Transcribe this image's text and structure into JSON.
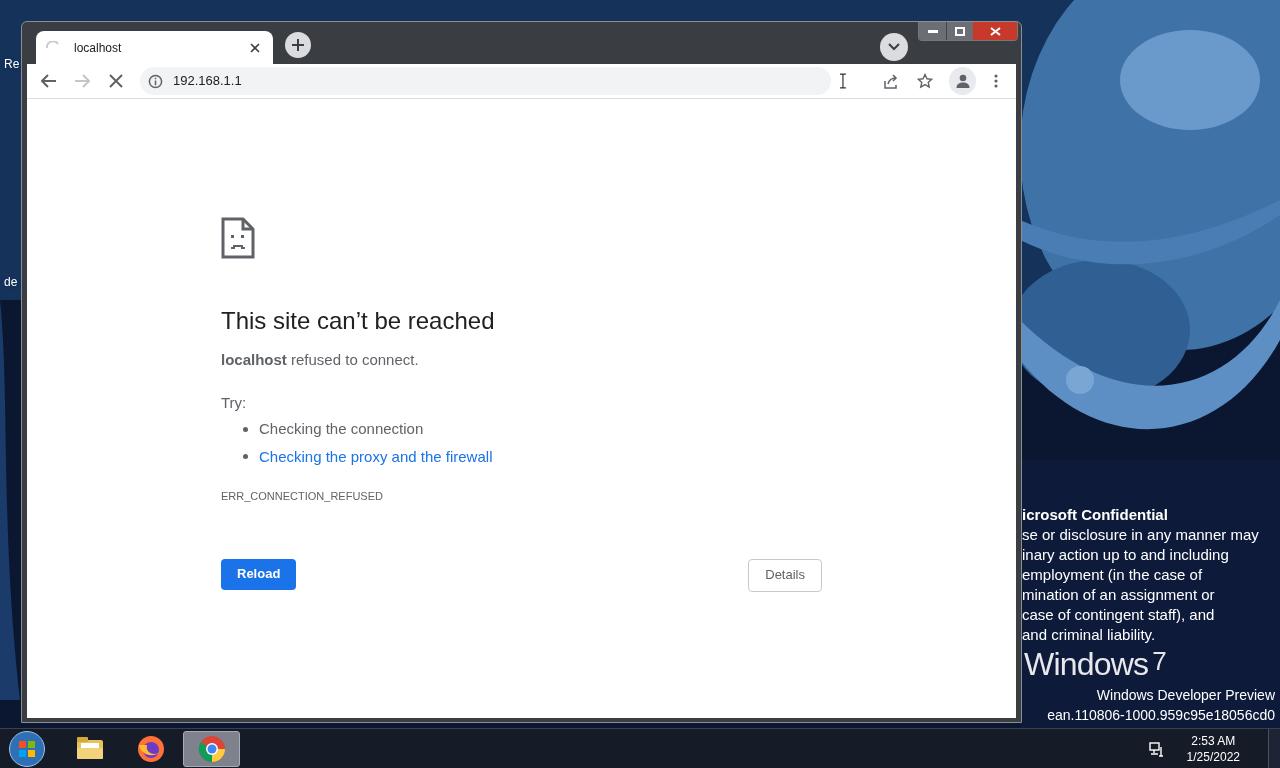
{
  "desktop": {
    "icon_labels": [
      "Re",
      "de"
    ],
    "notice": {
      "title": "icrosoft Confidential",
      "lines": [
        "se or disclosure in any manner may",
        "inary action up to and including",
        "employment (in the case of",
        "mination of an assignment or",
        "case of contingent staff), and",
        "and criminal liability."
      ]
    },
    "edition": "Windows Developer Preview",
    "build": "ean.110806-1000.959c95e18056cd0",
    "logo_word": "Windows",
    "logo_version": "7"
  },
  "browser": {
    "tabs": [
      {
        "title": "localhost",
        "selected": true,
        "loading": true
      }
    ],
    "address": "192.168.1.1",
    "loading": true,
    "page": {
      "heading": "This site can’t be reached",
      "message": "**localhost** refused to connect.",
      "try_label": "Try:",
      "suggestions": [
        {
          "text": "Checking the connection",
          "kind": "text"
        },
        {
          "text": "Checking the proxy and the firewall",
          "kind": "link"
        }
      ],
      "error_code": "ERR_CONNECTION_REFUSED",
      "buttons": [
        {
          "label": "Reload",
          "kind": "primary"
        },
        {
          "label": "Details",
          "kind": "secondary"
        }
      ]
    }
  },
  "taskbar": {
    "apps": [
      {
        "kind": "folder",
        "selected": false
      },
      {
        "kind": "firefox",
        "selected": false
      },
      {
        "kind": "chrome",
        "selected": true
      }
    ],
    "time": "2:53 AM",
    "date": "1/25/2022"
  }
}
